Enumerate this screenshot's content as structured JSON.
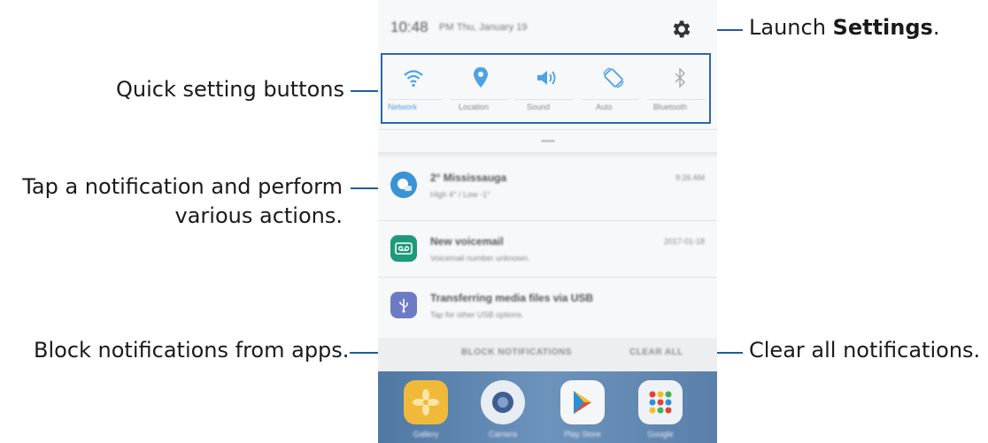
{
  "callouts": {
    "launch_prefix": "Launch ",
    "launch_bold": "Settings",
    "launch_suffix": ".",
    "quick_settings": "Quick setting buttons",
    "notification_line1": "Tap a notification and perform",
    "notification_line2": "various actions.",
    "block": "Block notifications from apps.",
    "clear": "Clear all notifications."
  },
  "phone": {
    "status": {
      "time": "10:48",
      "ampm": "PM",
      "date": "Thu, January 19"
    },
    "settings_icon": "gear-icon",
    "quick_settings": [
      {
        "icon": "wifi-icon",
        "label": "Network",
        "active": true
      },
      {
        "icon": "location-icon",
        "label": "Location",
        "active": true
      },
      {
        "icon": "sound-icon",
        "label": "Sound",
        "active": true
      },
      {
        "icon": "auto-rotate-icon",
        "label": "Auto",
        "active": true
      },
      {
        "icon": "bluetooth-icon",
        "label": "Bluetooth",
        "active": false
      }
    ],
    "notifications": [
      {
        "icon": "weather-icon",
        "title": "2° Mississauga",
        "subtitle": "High 4° / Low -1°",
        "time": "9:26 AM",
        "color": "#3a93d6"
      },
      {
        "icon": "voicemail-icon",
        "title": "New voicemail",
        "subtitle": "Voicemail number unknown.",
        "time": "2017-01-18",
        "color": "#1e9a7a"
      },
      {
        "icon": "usb-icon",
        "title": "Transferring media files via USB",
        "subtitle": "Tap for other USB options.",
        "time": "",
        "color": "#6d7bc4"
      }
    ],
    "actions": {
      "block": "BLOCK NOTIFICATIONS",
      "clear": "CLEAR ALL"
    },
    "home_apps": [
      {
        "icon": "gallery-icon",
        "label": "Gallery"
      },
      {
        "icon": "camera-icon",
        "label": "Camera"
      },
      {
        "icon": "play-store-icon",
        "label": "Play Store"
      },
      {
        "icon": "google-folder-icon",
        "label": "Google"
      }
    ]
  },
  "colors": {
    "callout_line": "#1f5d96",
    "highlight_box": "#2a68a5",
    "accent": "#5a9bd8"
  }
}
